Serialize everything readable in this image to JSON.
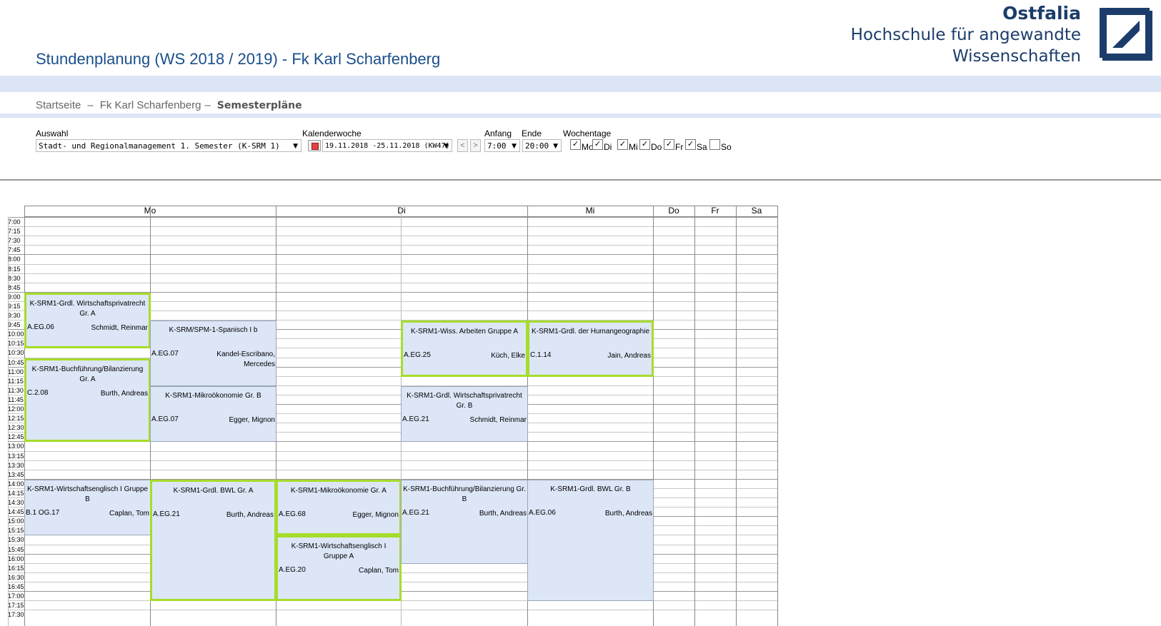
{
  "header": {
    "title": "Stundenplanung (WS 2018 / 2019) - Fk Karl Scharfenberg",
    "logo_brand": "Ostfalia",
    "logo_line1": "Hochschule für angewandte",
    "logo_line2": "Wissenschaften"
  },
  "breadcrumb": {
    "home": "Startseite",
    "separator": "–",
    "faculty": "Fk Karl Scharfenberg",
    "current": "Semesterpläne"
  },
  "filters": {
    "auswahl_label": "Auswahl",
    "auswahl_value": "Stadt- und Regionalmanagement 1. Semester (K-SRM 1)",
    "kw_label": "Kalenderwoche",
    "kw_value": "19.11.2018 -25.11.2018 (KW47)",
    "prev": "<",
    "next": ">",
    "anfang_label": "Anfang",
    "anfang_value": "7:00",
    "ende_label": "Ende",
    "ende_value": "20:00",
    "wochentage_label": "Wochentage",
    "days": [
      {
        "label": "Mo",
        "checked": true
      },
      {
        "label": "Di",
        "checked": true
      },
      {
        "label": "Mi",
        "checked": true
      },
      {
        "label": "Do",
        "checked": true
      },
      {
        "label": "Fr",
        "checked": true
      },
      {
        "label": "Sa",
        "checked": true
      },
      {
        "label": "So",
        "checked": false
      }
    ]
  },
  "timetable": {
    "days": [
      "Mo",
      "Di",
      "Mi",
      "Do",
      "Fr",
      "Sa"
    ],
    "times": [
      "7:00",
      "7:15",
      "7:30",
      "7:45",
      "8:00",
      "8:15",
      "8:30",
      "8:45",
      "9:00",
      "9:15",
      "9:30",
      "9:45",
      "10:00",
      "10:15",
      "10:30",
      "10:45",
      "11:00",
      "11:15",
      "11:30",
      "11:45",
      "12:00",
      "12:15",
      "12:30",
      "12:45",
      "13:00",
      "13:15",
      "13:30",
      "13:45",
      "14:00",
      "14:15",
      "14:30",
      "14:45",
      "15:00",
      "15:15",
      "15:30",
      "15:45",
      "16:00",
      "16:15",
      "16:30",
      "16:45",
      "17:00",
      "17:15",
      "17:30"
    ],
    "events": [
      {
        "day": "Mo",
        "sub": 0,
        "start": "9:00",
        "end": "10:30",
        "title": "K-SRM1-Grdl. Wirtschaftsprivatrecht Gr. A",
        "room": "A.EG.06",
        "person": "Schmidt, Reinmar",
        "highlight": true
      },
      {
        "day": "Mo",
        "sub": 0,
        "start": "10:45",
        "end": "13:00",
        "title": "K-SRM1-Buchführung/Bilanzierung Gr. A",
        "room": "C.2.08",
        "person": "Burth, Andreas",
        "highlight": true
      },
      {
        "day": "Mo",
        "sub": 0,
        "start": "14:00",
        "end": "15:30",
        "title": "K-SRM1-Wirtschaftsenglisch I Gruppe B",
        "room": "B.1 OG.17",
        "person": "Caplan, Tom",
        "highlight": false
      },
      {
        "day": "Mo",
        "sub": 1,
        "start": "9:45",
        "end": "11:30",
        "title": "K-SRM/SPM-1-Spanisch I b",
        "room": "A.EG.07",
        "person": "Kandel-Escribano, Mercedes",
        "highlight": false
      },
      {
        "day": "Mo",
        "sub": 1,
        "start": "11:30",
        "end": "13:00",
        "title": "K-SRM1-Mikroökonomie Gr. B",
        "room": "A.EG.07",
        "person": "Egger, Mignon",
        "highlight": false
      },
      {
        "day": "Mo",
        "sub": 1,
        "start": "14:00",
        "end": "17:15",
        "title": "K-SRM1-Grdl. BWL Gr. A",
        "room": "A.EG.21",
        "person": "Burth, Andreas",
        "highlight": true
      },
      {
        "day": "Di",
        "sub": 0,
        "start": "14:00",
        "end": "15:30",
        "title": "K-SRM1-Mikroökonomie Gr. A",
        "room": "A.EG.68",
        "person": "Egger, Mignon",
        "highlight": true
      },
      {
        "day": "Di",
        "sub": 0,
        "start": "15:30",
        "end": "17:15",
        "title": "K-SRM1-Wirtschaftsenglisch I Gruppe A",
        "room": "A.EG.20",
        "person": "Caplan, Tom",
        "highlight": true
      },
      {
        "day": "Di",
        "sub": 1,
        "start": "9:45",
        "end": "11:15",
        "title": "K-SRM1-Wiss. Arbeiten Gruppe A",
        "room": "A.EG.25",
        "person": "Küch, Elke",
        "highlight": true
      },
      {
        "day": "Di",
        "sub": 1,
        "start": "11:30",
        "end": "13:00",
        "title": "K-SRM1-Grdl. Wirtschaftsprivatrecht Gr. B",
        "room": "A.EG.21",
        "person": "Schmidt, Reinmar",
        "highlight": false
      },
      {
        "day": "Di",
        "sub": 1,
        "start": "14:00",
        "end": "16:15",
        "title": "K-SRM1-Buchführung/Bilanzierung Gr. B",
        "room": "A.EG.21",
        "person": "Burth, Andreas",
        "highlight": false
      },
      {
        "day": "Mi",
        "sub": 0,
        "start": "9:45",
        "end": "11:15",
        "title": "K-SRM1-Grdl. der Humangeographie",
        "room": "C.1.14",
        "person": "Jain, Andreas",
        "highlight": true
      },
      {
        "day": "Mi",
        "sub": 0,
        "start": "14:00",
        "end": "17:15",
        "title": "K-SRM1-Grdl. BWL Gr. B",
        "room": "A.EG.06",
        "person": "Burth, Andreas",
        "highlight": false
      }
    ]
  },
  "colors": {
    "title_blue": "#1a4f8a",
    "band": "#dbe5f6",
    "event_fill": "#dce6f7",
    "highlight_border": "#a6dc2a"
  }
}
